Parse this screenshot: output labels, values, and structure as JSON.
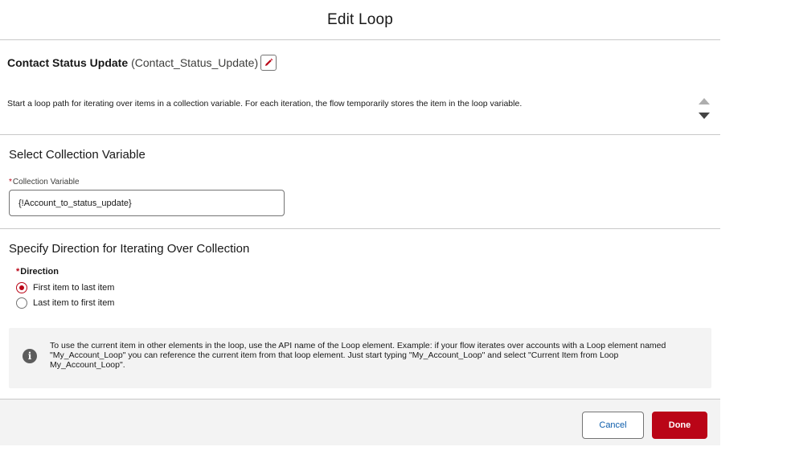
{
  "modal": {
    "title": "Edit Loop"
  },
  "element": {
    "label": "Contact Status Update",
    "api_name": "(Contact_Status_Update)",
    "edit_icon": "pencil-icon",
    "description": "Start a loop path for iterating over items in a collection variable. For each iteration, the flow temporarily stores the item in the loop variable."
  },
  "collection_section": {
    "title": "Select Collection Variable",
    "field_label": "Collection Variable",
    "required_marker": "*",
    "value": "{!Account_to_status_update}"
  },
  "direction_section": {
    "title": "Specify Direction for Iterating Over Collection",
    "field_label": "Direction",
    "required_marker": "*",
    "options": [
      {
        "label": "First item to last item",
        "selected": true
      },
      {
        "label": "Last item to first item",
        "selected": false
      }
    ]
  },
  "info": {
    "icon": "info-icon",
    "text": "To use the current item in other elements in the loop, use the API name of the Loop element. Example: if your flow iterates over accounts with a Loop element named \"My_Account_Loop\" you can reference the current item from that loop element. Just start typing \"My_Account_Loop\" and select \"Current Item from Loop My_Account_Loop\"."
  },
  "footer": {
    "cancel_label": "Cancel",
    "done_label": "Done"
  },
  "colors": {
    "brand_red": "#ba0517",
    "link_blue": "#0b5cab",
    "panel_gray": "#f3f3f3",
    "border_gray": "#c9c9c9"
  }
}
